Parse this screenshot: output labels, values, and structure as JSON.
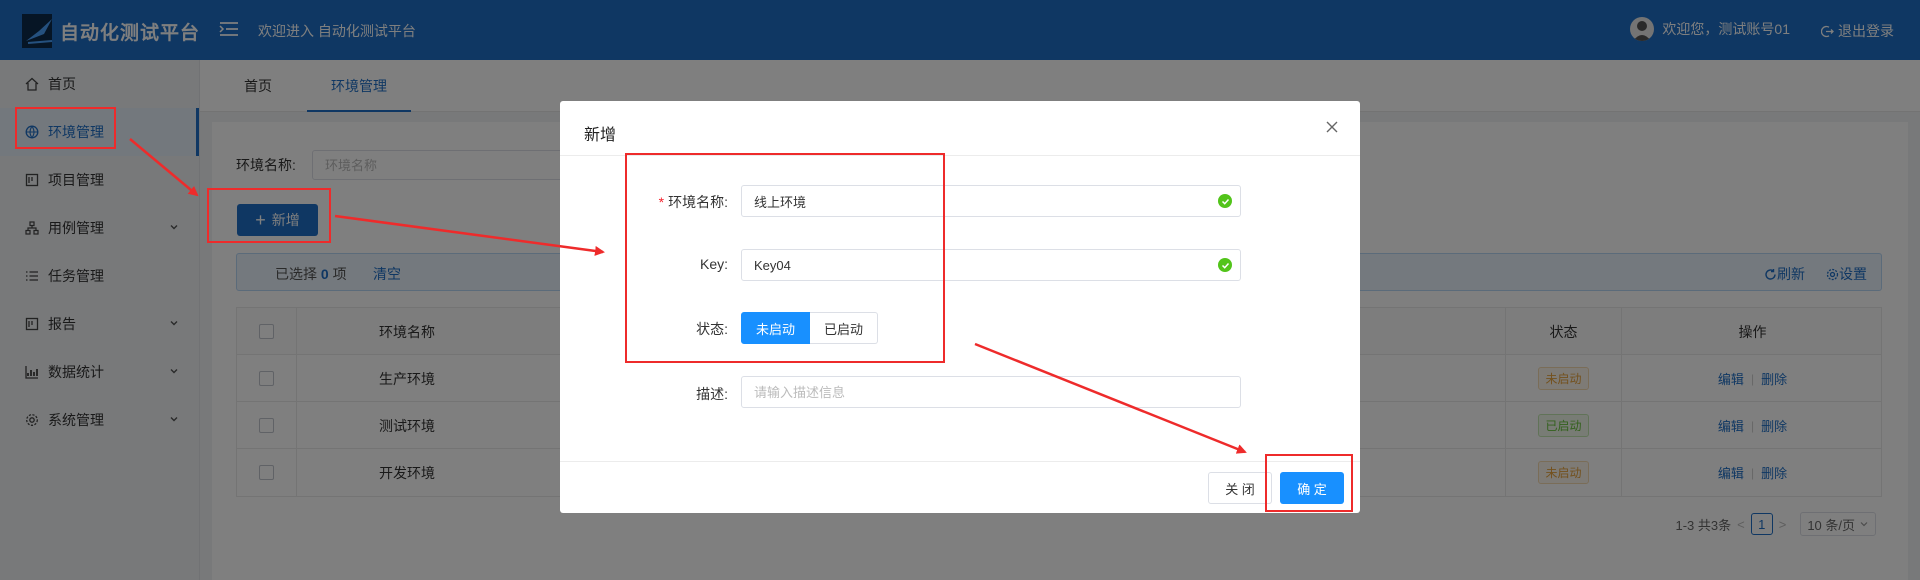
{
  "header": {
    "app_title": "自动化测试平台",
    "welcome": "欢迎进入 自动化测试平台",
    "user_greeting": "欢迎您，测试账号01",
    "logout": "退出登录"
  },
  "sidebar": {
    "items": [
      {
        "label": "首页",
        "icon": "home-icon"
      },
      {
        "label": "环境管理",
        "icon": "globe-icon"
      },
      {
        "label": "项目管理",
        "icon": "project-icon"
      },
      {
        "label": "用例管理",
        "icon": "case-icon"
      },
      {
        "label": "任务管理",
        "icon": "list-icon"
      },
      {
        "label": "报告",
        "icon": "report-icon"
      },
      {
        "label": "数据统计",
        "icon": "chart-icon"
      },
      {
        "label": "系统管理",
        "icon": "gear-icon"
      }
    ]
  },
  "tabs": [
    {
      "label": "首页"
    },
    {
      "label": "环境管理"
    }
  ],
  "filter": {
    "label": "环境名称:",
    "placeholder": "环境名称"
  },
  "toolbar": {
    "add_label": "新增"
  },
  "selection": {
    "prefix": "已选择",
    "count": "0",
    "suffix": "项",
    "clear": "清空",
    "refresh": "刷新",
    "settings": "设置"
  },
  "table": {
    "headers": {
      "name": "环境名称",
      "status": "状态",
      "ops": "操作"
    },
    "rows": [
      {
        "name": "生产环境",
        "status": "未启动",
        "status_kind": "off"
      },
      {
        "name": "测试环境",
        "status": "已启动",
        "status_kind": "on"
      },
      {
        "name": "开发环境",
        "status": "未启动",
        "status_kind": "off"
      }
    ],
    "edit": "编辑",
    "delete": "删除"
  },
  "pager": {
    "total": "1-3 共3条",
    "page": "1",
    "size": "10 条/页"
  },
  "dialog": {
    "title": "新增",
    "name_label": "环境名称:",
    "name_value": "线上环境",
    "key_label": "Key:",
    "key_value": "Key04",
    "status_label": "状态:",
    "status_options": [
      "未启动",
      "已启动"
    ],
    "desc_label": "描述:",
    "desc_placeholder": "请输入描述信息",
    "close_label": "关 闭",
    "ok_label": "确 定"
  },
  "colors": {
    "primary": "#1f6fc6",
    "dialog_primary": "#1890ff",
    "annotation": "#ee2b2b"
  }
}
